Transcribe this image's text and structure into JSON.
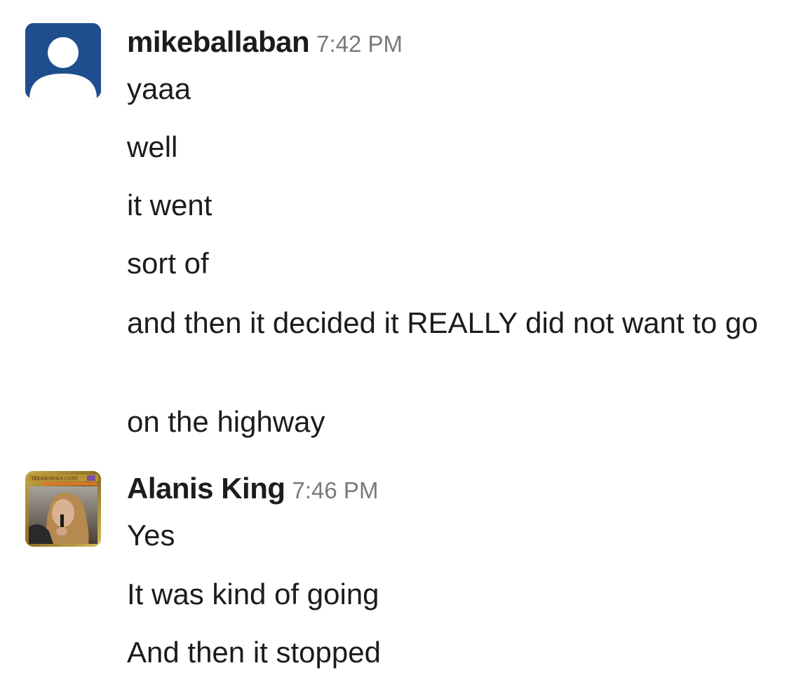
{
  "messages": [
    {
      "author": "mikeballaban",
      "time": "7:42 PM",
      "lines": [
        "yaaa",
        "well",
        "it went",
        "sort of",
        "and then it decided it REALLY did not want to go",
        "on the highway"
      ]
    },
    {
      "author": "Alanis King",
      "time": "7:46 PM",
      "avatar_caption": "TREASONOUS CUNT",
      "lines": [
        "Yes",
        "It was kind of going",
        "And then it stopped"
      ]
    }
  ],
  "colors": {
    "text": "#1d1c1d",
    "timestamp": "#7a7a7a",
    "default_avatar_bg": "#1f4e8f"
  },
  "icons": {
    "default_avatar": "user-silhouette-icon",
    "photo_avatar": "trading-card-photo"
  }
}
